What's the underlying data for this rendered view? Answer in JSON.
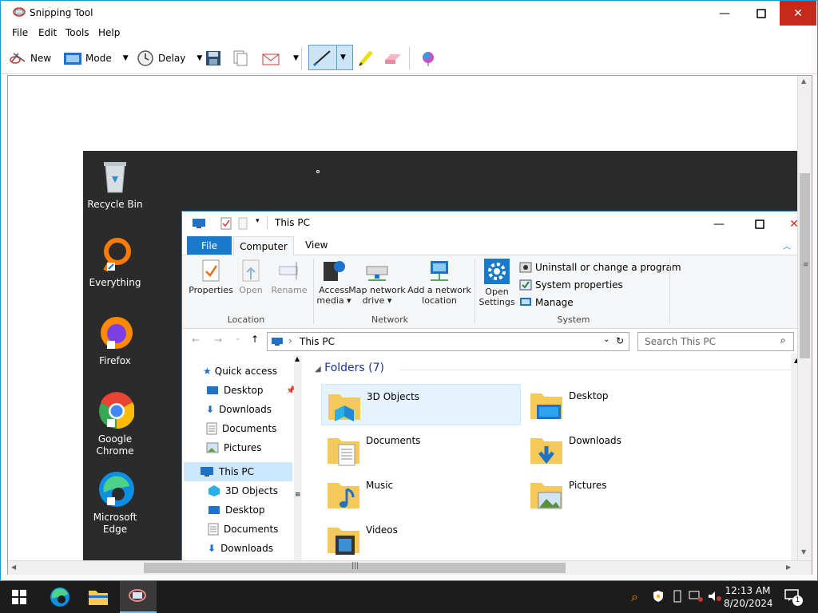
{
  "snipping_tool": {
    "title": "Snipping Tool",
    "menu": [
      "File",
      "Edit",
      "Tools",
      "Help"
    ],
    "toolbar": {
      "new": "New",
      "mode": "Mode",
      "delay": "Delay"
    }
  },
  "desktop": {
    "icons": [
      {
        "label": "Recycle Bin",
        "icon": "recycle-bin-icon"
      },
      {
        "label": "Everything",
        "icon": "everything-icon"
      },
      {
        "label": "Firefox",
        "icon": "firefox-icon"
      },
      {
        "label": "Google Chrome",
        "icon": "chrome-icon"
      },
      {
        "label": "Microsoft Edge",
        "icon": "edge-icon"
      }
    ]
  },
  "explorer": {
    "title": "This PC",
    "tabs": [
      "File",
      "Computer",
      "View"
    ],
    "ribbon": {
      "location": {
        "group": "Location",
        "items": [
          "Properties",
          "Open",
          "Rename"
        ]
      },
      "network": {
        "group": "Network",
        "items": [
          "Access media",
          "Map network drive",
          "Add a network location"
        ]
      },
      "system": {
        "group": "System",
        "open_settings": "Open Settings",
        "items": [
          "Uninstall or change a program",
          "System properties",
          "Manage"
        ]
      }
    },
    "address": {
      "path": "This PC",
      "search_placeholder": "Search This PC"
    },
    "nav": {
      "quick_access": "Quick access",
      "quick_items": [
        "Desktop",
        "Downloads",
        "Documents",
        "Pictures"
      ],
      "this_pc": "This PC",
      "pc_items": [
        "3D Objects",
        "Desktop",
        "Documents",
        "Downloads"
      ]
    },
    "folders_header": "Folders (7)",
    "folders": [
      "3D Objects",
      "Desktop",
      "Documents",
      "Downloads",
      "Music",
      "Pictures",
      "Videos"
    ]
  },
  "taskbar": {
    "time": "12:13 AM",
    "date": "8/20/2024",
    "notif_count": "1"
  }
}
